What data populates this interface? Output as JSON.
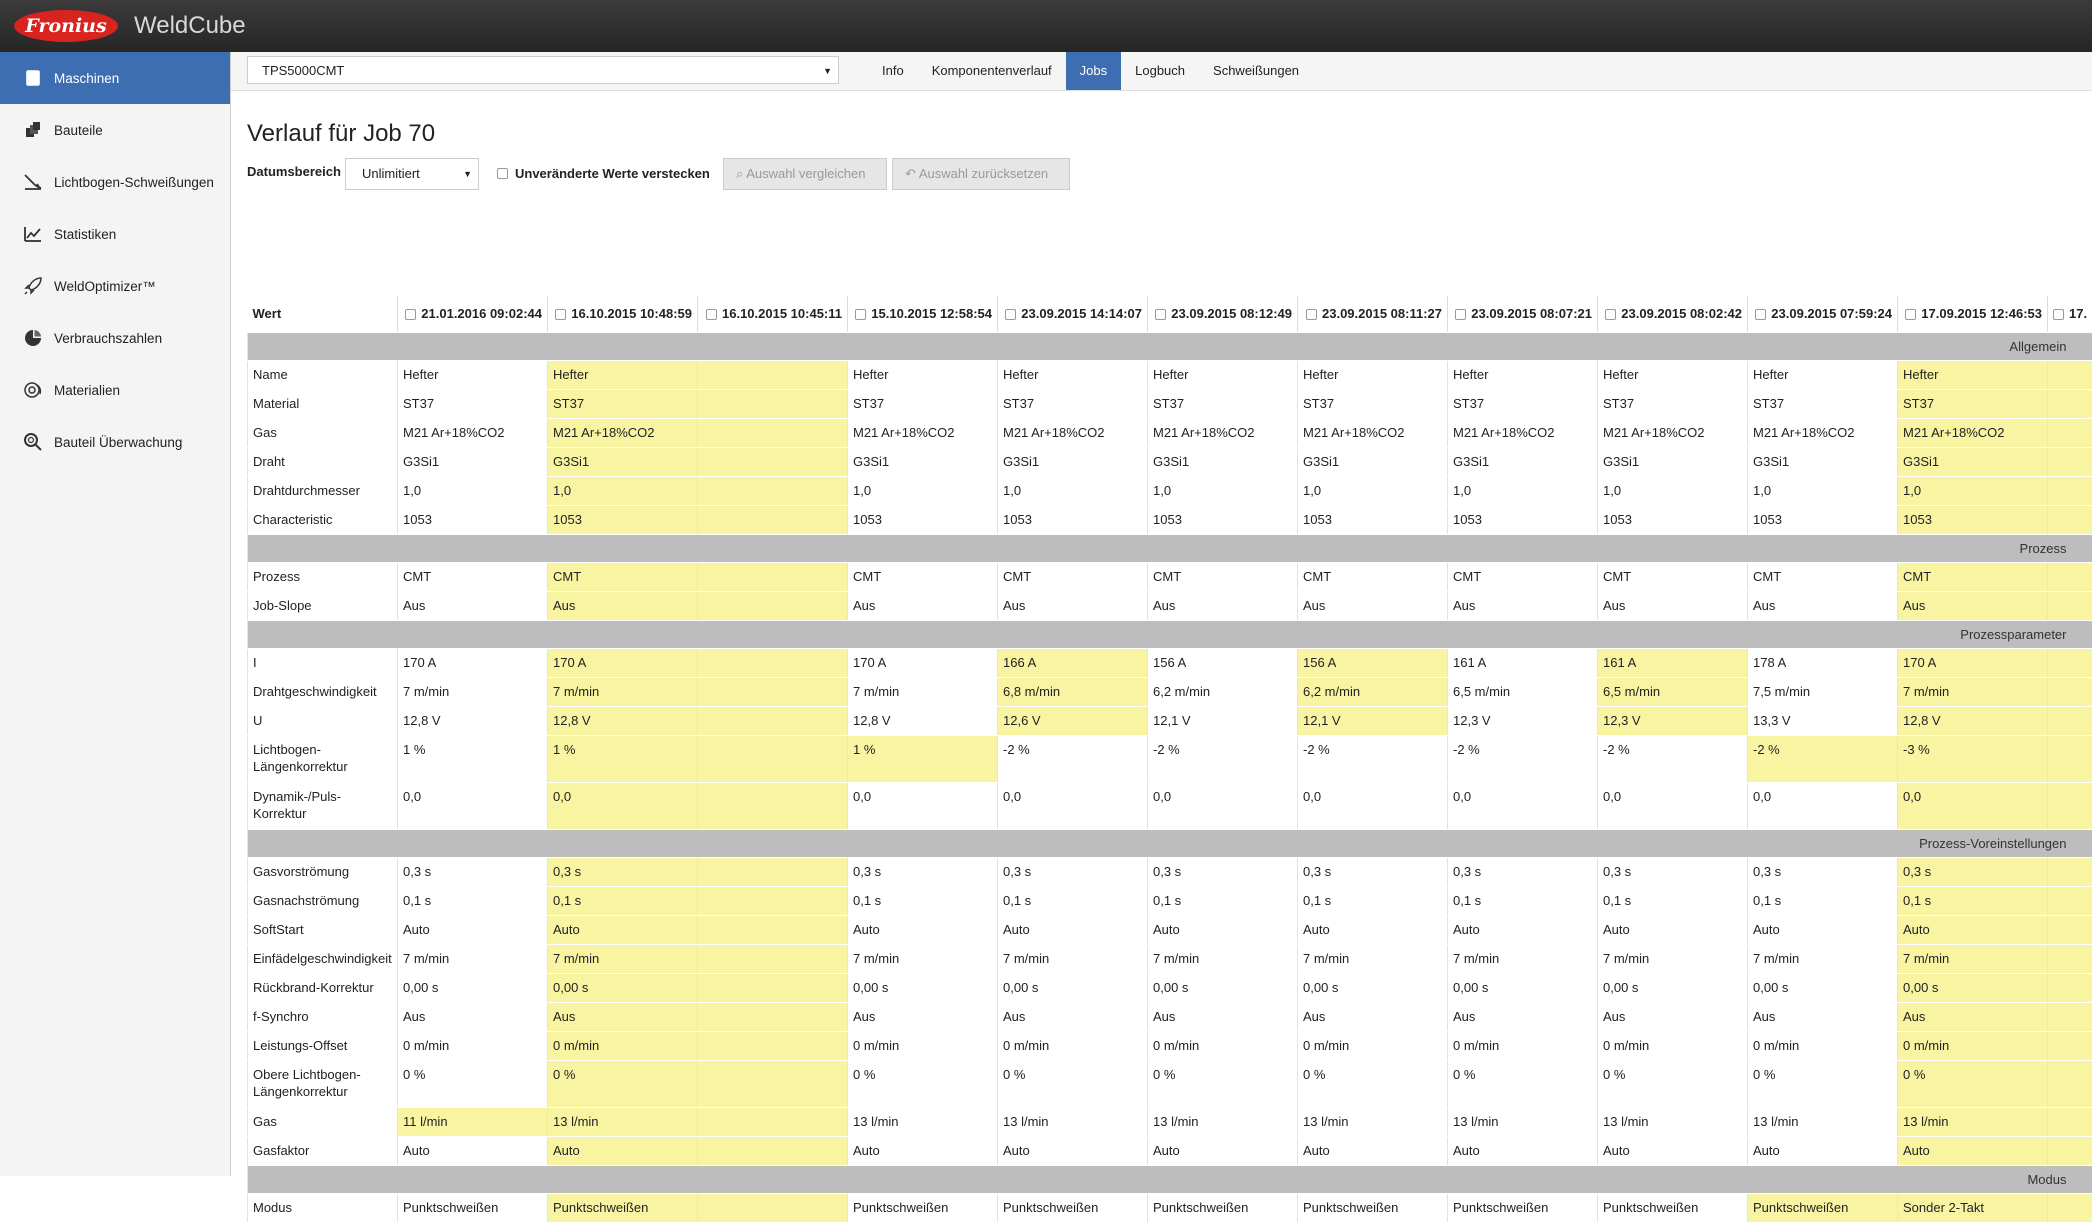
{
  "brand": {
    "logo_text": "Fronius",
    "app_name": "WeldCube",
    "accent": "#3d6eb2",
    "highlight": "#f8f4a2"
  },
  "sidebar": {
    "items": [
      {
        "label": "Maschinen",
        "icon": "machine-icon",
        "active": true
      },
      {
        "label": "Bauteile",
        "icon": "parts-icon"
      },
      {
        "label": "Lichtbogen-Schweißungen",
        "icon": "weld-arc-icon"
      },
      {
        "label": "Statistiken",
        "icon": "statistics-icon"
      },
      {
        "label": "WeldOptimizer™",
        "icon": "rocket-icon"
      },
      {
        "label": "Verbrauchszahlen",
        "icon": "pie-chart-icon"
      },
      {
        "label": "Materialien",
        "icon": "wire-spool-icon"
      },
      {
        "label": "Bauteil Überwachung",
        "icon": "magnifier-icon"
      }
    ]
  },
  "toolbar": {
    "machine": "TPS5000CMT",
    "tabs": [
      {
        "label": "Info"
      },
      {
        "label": "Komponentenverlauf"
      },
      {
        "label": "Jobs",
        "active": true
      },
      {
        "label": "Logbuch"
      },
      {
        "label": "Schweißungen"
      }
    ]
  },
  "page": {
    "title": "Verlauf für Job 70",
    "date_range_label": "Datumsbereich",
    "date_range_value": "Unlimitiert",
    "hide_unchanged_label": "Unveränderte Werte verstecken",
    "compare_button": "Auswahl vergleichen",
    "reset_button": "Auswahl zurücksetzen"
  },
  "table": {
    "value_header": "Wert",
    "columns": [
      "21.01.2016 09:02:44",
      "16.10.2015 10:48:59",
      "16.10.2015 10:45:11",
      "15.10.2015 12:58:54",
      "23.09.2015 14:14:07",
      "23.09.2015 08:12:49",
      "23.09.2015 08:11:27",
      "23.09.2015 08:07:21",
      "23.09.2015 08:02:42",
      "23.09.2015 07:59:24",
      "17.09.2015 12:46:53",
      "17."
    ],
    "rows": [
      {
        "section": "Allgemein"
      },
      {
        "label": "Name",
        "values": [
          "Hefter",
          "Hefter",
          "",
          "Hefter",
          "Hefter",
          "Hefter",
          "Hefter",
          "Hefter",
          "Hefter",
          "Hefter",
          "Hefter",
          ""
        ],
        "hl": [
          1,
          2,
          10,
          11
        ]
      },
      {
        "label": "Material",
        "values": [
          "ST37",
          "ST37",
          "",
          "ST37",
          "ST37",
          "ST37",
          "ST37",
          "ST37",
          "ST37",
          "ST37",
          "ST37",
          ""
        ],
        "hl": [
          1,
          2,
          10,
          11
        ]
      },
      {
        "label": "Gas",
        "values": [
          "M21 Ar+18%CO2",
          "M21 Ar+18%CO2",
          "",
          "M21 Ar+18%CO2",
          "M21 Ar+18%CO2",
          "M21 Ar+18%CO2",
          "M21 Ar+18%CO2",
          "M21 Ar+18%CO2",
          "M21 Ar+18%CO2",
          "M21 Ar+18%CO2",
          "M21 Ar+18%CO2",
          ""
        ],
        "hl": [
          1,
          2,
          10,
          11
        ]
      },
      {
        "label": "Draht",
        "values": [
          "G3Si1",
          "G3Si1",
          "",
          "G3Si1",
          "G3Si1",
          "G3Si1",
          "G3Si1",
          "G3Si1",
          "G3Si1",
          "G3Si1",
          "G3Si1",
          ""
        ],
        "hl": [
          1,
          2,
          10,
          11
        ]
      },
      {
        "label": "Drahtdurchmesser",
        "values": [
          "1,0",
          "1,0",
          "",
          "1,0",
          "1,0",
          "1,0",
          "1,0",
          "1,0",
          "1,0",
          "1,0",
          "1,0",
          ""
        ],
        "hl": [
          1,
          2,
          10,
          11
        ]
      },
      {
        "label": "Characteristic",
        "values": [
          "1053",
          "1053",
          "",
          "1053",
          "1053",
          "1053",
          "1053",
          "1053",
          "1053",
          "1053",
          "1053",
          ""
        ],
        "hl": [
          1,
          2,
          10,
          11
        ]
      },
      {
        "section": "Prozess"
      },
      {
        "label": "Prozess",
        "values": [
          "CMT",
          "CMT",
          "",
          "CMT",
          "CMT",
          "CMT",
          "CMT",
          "CMT",
          "CMT",
          "CMT",
          "CMT",
          ""
        ],
        "hl": [
          1,
          2,
          10,
          11
        ]
      },
      {
        "label": "Job-Slope",
        "values": [
          "Aus",
          "Aus",
          "",
          "Aus",
          "Aus",
          "Aus",
          "Aus",
          "Aus",
          "Aus",
          "Aus",
          "Aus",
          ""
        ],
        "hl": [
          1,
          2,
          10,
          11
        ]
      },
      {
        "section": "Prozessparameter"
      },
      {
        "label": "I",
        "values": [
          "170 A",
          "170 A",
          "",
          "170 A",
          "166 A",
          "156 A",
          "156 A",
          "161 A",
          "161 A",
          "178 A",
          "170 A",
          ""
        ],
        "hl": [
          1,
          2,
          4,
          6,
          8,
          10,
          11
        ]
      },
      {
        "label": "Drahtgeschwindigkeit",
        "values": [
          "7 m/min",
          "7 m/min",
          "",
          "7 m/min",
          "6,8 m/min",
          "6,2 m/min",
          "6,2 m/min",
          "6,5 m/min",
          "6,5 m/min",
          "7,5 m/min",
          "7 m/min",
          ""
        ],
        "hl": [
          1,
          2,
          4,
          6,
          8,
          10,
          11
        ]
      },
      {
        "label": "U",
        "values": [
          "12,8 V",
          "12,8 V",
          "",
          "12,8 V",
          "12,6 V",
          "12,1 V",
          "12,1 V",
          "12,3 V",
          "12,3 V",
          "13,3 V",
          "12,8 V",
          ""
        ],
        "hl": [
          1,
          2,
          4,
          6,
          8,
          10,
          11
        ]
      },
      {
        "label": "Lichtbogen-Längenkorrektur",
        "tall": true,
        "values": [
          "1 %",
          "1 %",
          "",
          "1 %",
          "-2 %",
          "-2 %",
          "-2 %",
          "-2 %",
          "-2 %",
          "-2 %",
          "-3 %",
          ""
        ],
        "hl": [
          1,
          2,
          3,
          9,
          10,
          11
        ]
      },
      {
        "label": "Dynamik-/Puls-Korrektur",
        "tall": true,
        "values": [
          "0,0",
          "0,0",
          "",
          "0,0",
          "0,0",
          "0,0",
          "0,0",
          "0,0",
          "0,0",
          "0,0",
          "0,0",
          ""
        ],
        "hl": [
          1,
          2,
          10,
          11
        ]
      },
      {
        "section": "Prozess-Voreinstellungen"
      },
      {
        "label": "Gasvorströmung",
        "values": [
          "0,3 s",
          "0,3 s",
          "",
          "0,3 s",
          "0,3 s",
          "0,3 s",
          "0,3 s",
          "0,3 s",
          "0,3 s",
          "0,3 s",
          "0,3 s",
          ""
        ],
        "hl": [
          1,
          2,
          10,
          11
        ]
      },
      {
        "label": "Gasnachströmung",
        "values": [
          "0,1 s",
          "0,1 s",
          "",
          "0,1 s",
          "0,1 s",
          "0,1 s",
          "0,1 s",
          "0,1 s",
          "0,1 s",
          "0,1 s",
          "0,1 s",
          ""
        ],
        "hl": [
          1,
          2,
          10,
          11
        ]
      },
      {
        "label": "SoftStart",
        "values": [
          "Auto",
          "Auto",
          "",
          "Auto",
          "Auto",
          "Auto",
          "Auto",
          "Auto",
          "Auto",
          "Auto",
          "Auto",
          ""
        ],
        "hl": [
          1,
          2,
          10,
          11
        ]
      },
      {
        "label": "Einfädelgeschwindigkeit",
        "values": [
          "7 m/min",
          "7 m/min",
          "",
          "7 m/min",
          "7 m/min",
          "7 m/min",
          "7 m/min",
          "7 m/min",
          "7 m/min",
          "7 m/min",
          "7 m/min",
          ""
        ],
        "hl": [
          1,
          2,
          10,
          11
        ]
      },
      {
        "label": "Rückbrand-Korrektur",
        "values": [
          "0,00 s",
          "0,00 s",
          "",
          "0,00 s",
          "0,00 s",
          "0,00 s",
          "0,00 s",
          "0,00 s",
          "0,00 s",
          "0,00 s",
          "0,00 s",
          ""
        ],
        "hl": [
          1,
          2,
          10,
          11
        ]
      },
      {
        "label": "f-Synchro",
        "values": [
          "Aus",
          "Aus",
          "",
          "Aus",
          "Aus",
          "Aus",
          "Aus",
          "Aus",
          "Aus",
          "Aus",
          "Aus",
          ""
        ],
        "hl": [
          1,
          2,
          10,
          11
        ]
      },
      {
        "label": "Leistungs-Offset",
        "values": [
          "0 m/min",
          "0 m/min",
          "",
          "0 m/min",
          "0 m/min",
          "0 m/min",
          "0 m/min",
          "0 m/min",
          "0 m/min",
          "0 m/min",
          "0 m/min",
          ""
        ],
        "hl": [
          1,
          2,
          10,
          11
        ]
      },
      {
        "label": "Obere Lichtbogen-Längenkorrektur",
        "tall": true,
        "values": [
          "0 %",
          "0 %",
          "",
          "0 %",
          "0 %",
          "0 %",
          "0 %",
          "0 %",
          "0 %",
          "0 %",
          "0 %",
          ""
        ],
        "hl": [
          1,
          2,
          10,
          11
        ]
      },
      {
        "label": "Gas",
        "values": [
          "11 l/min",
          "13 l/min",
          "",
          "13 l/min",
          "13 l/min",
          "13 l/min",
          "13 l/min",
          "13 l/min",
          "13 l/min",
          "13 l/min",
          "13 l/min",
          ""
        ],
        "hl": [
          0,
          1,
          2,
          10,
          11
        ]
      },
      {
        "label": "Gasfaktor",
        "values": [
          "Auto",
          "Auto",
          "",
          "Auto",
          "Auto",
          "Auto",
          "Auto",
          "Auto",
          "Auto",
          "Auto",
          "Auto",
          ""
        ],
        "hl": [
          1,
          2,
          10,
          11
        ]
      },
      {
        "section": "Modus"
      },
      {
        "label": "Modus",
        "values": [
          "Punktschweißen",
          "Punktschweißen",
          "",
          "Punktschweißen",
          "Punktschweißen",
          "Punktschweißen",
          "Punktschweißen",
          "Punktschweißen",
          "Punktschweißen",
          "Punktschweißen",
          "Sonder 2-Takt",
          ""
        ],
        "hl": [
          1,
          2,
          9,
          10,
          11
        ]
      }
    ]
  }
}
